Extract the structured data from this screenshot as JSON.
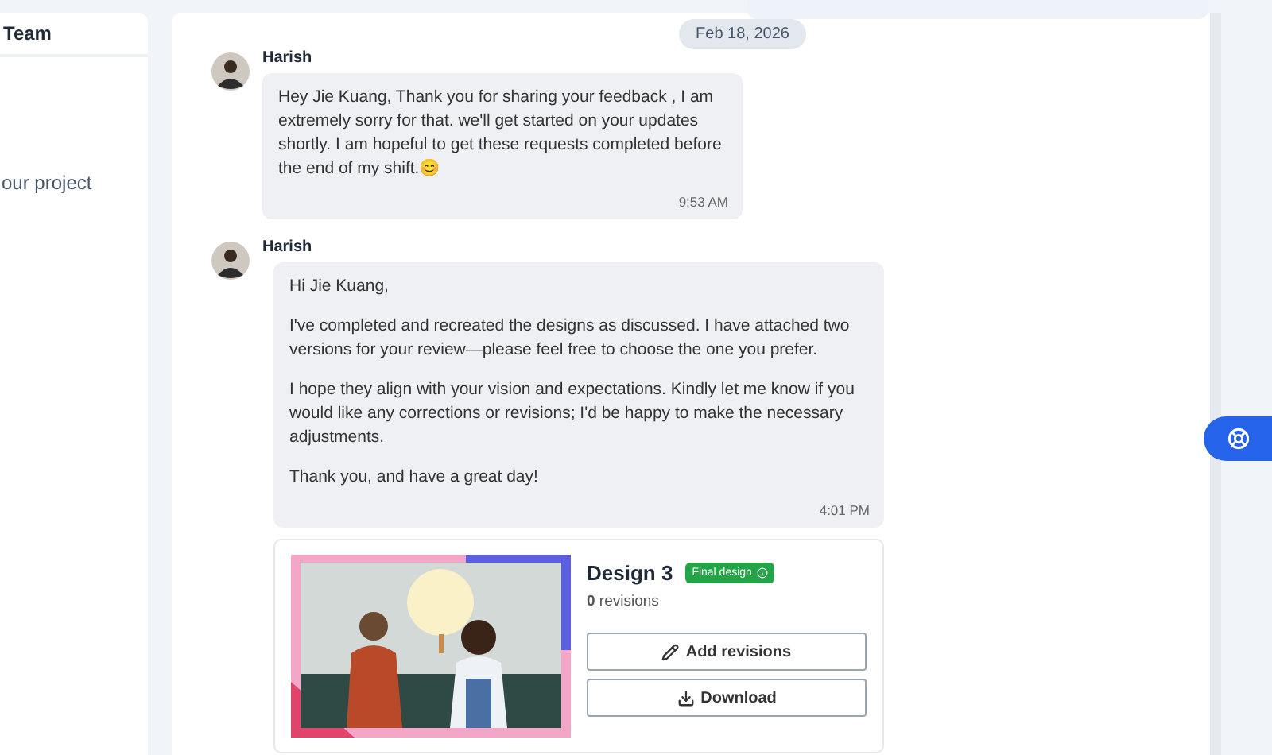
{
  "sidebar": {
    "title": "Team",
    "items": [
      "our project"
    ]
  },
  "date_divider": "Feb 18, 2026",
  "messages": [
    {
      "sender": "Harish",
      "paragraphs": [
        "Hey Jie Kuang, Thank you for sharing your feedback , I am extremely sorry for that. we'll get started on your updates shortly. I am hopeful to get these requests completed before the end of my shift.😊"
      ],
      "time": "9:53 AM"
    },
    {
      "sender": "Harish",
      "paragraphs": [
        "Hi Jie Kuang,",
        "I've completed and recreated the designs as discussed. I have attached two versions for your review—please feel free to choose the one you prefer.",
        "I hope they align with your vision and expectations. Kindly let me know if you would like any corrections or revisions; I'd be happy to make the necessary adjustments.",
        "Thank you, and have a great day!"
      ],
      "time": "4:01 PM",
      "attachment": {
        "kind": "picture",
        "title": "Design 3",
        "badge": "Final design",
        "revisions": "**0** revisions",
        "buttons": [
          {
            "kind": "edit",
            "label": "Add revisions"
          },
          {
            "kind": "download",
            "label": "Download"
          }
        ]
      }
    }
  ]
}
